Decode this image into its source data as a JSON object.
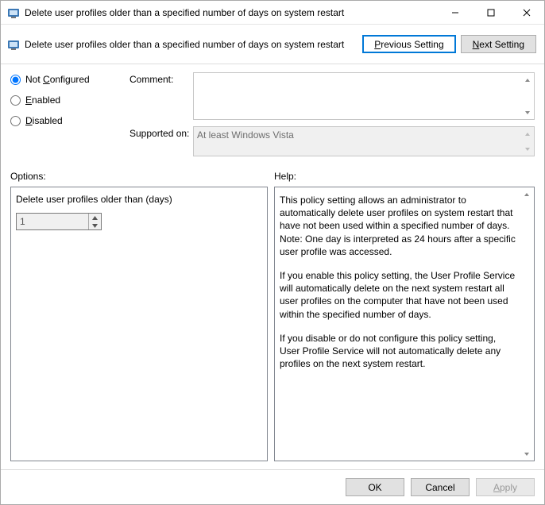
{
  "window": {
    "title": "Delete user profiles older than a specified number of days on system restart"
  },
  "header": {
    "title": "Delete user profiles older than a specified number of days on system restart",
    "prev": "Previous Setting",
    "next": "Next Setting"
  },
  "state": {
    "not_configured": "Not Configured",
    "enabled": "Enabled",
    "disabled": "Disabled",
    "selected": "not_configured"
  },
  "comment": {
    "label": "Comment:",
    "value": ""
  },
  "supported": {
    "label": "Supported on:",
    "value": "At least Windows Vista"
  },
  "sections": {
    "options": "Options:",
    "help": "Help:"
  },
  "options": {
    "days_label": "Delete user profiles older than (days)",
    "days_value": "1"
  },
  "help": {
    "p1": "This policy setting allows an administrator to automatically delete user profiles on system restart that have not been used within a specified number of days. Note: One day is interpreted as 24 hours after a specific user profile was accessed.",
    "p2": "If you enable this policy setting, the User Profile Service will automatically delete on the next system restart all user profiles on the computer that have not been used within the specified number of days.",
    "p3": "If you disable or do not configure this policy setting, User Profile Service will not automatically delete any profiles on the next system restart."
  },
  "footer": {
    "ok": "OK",
    "cancel": "Cancel",
    "apply": "Apply"
  }
}
